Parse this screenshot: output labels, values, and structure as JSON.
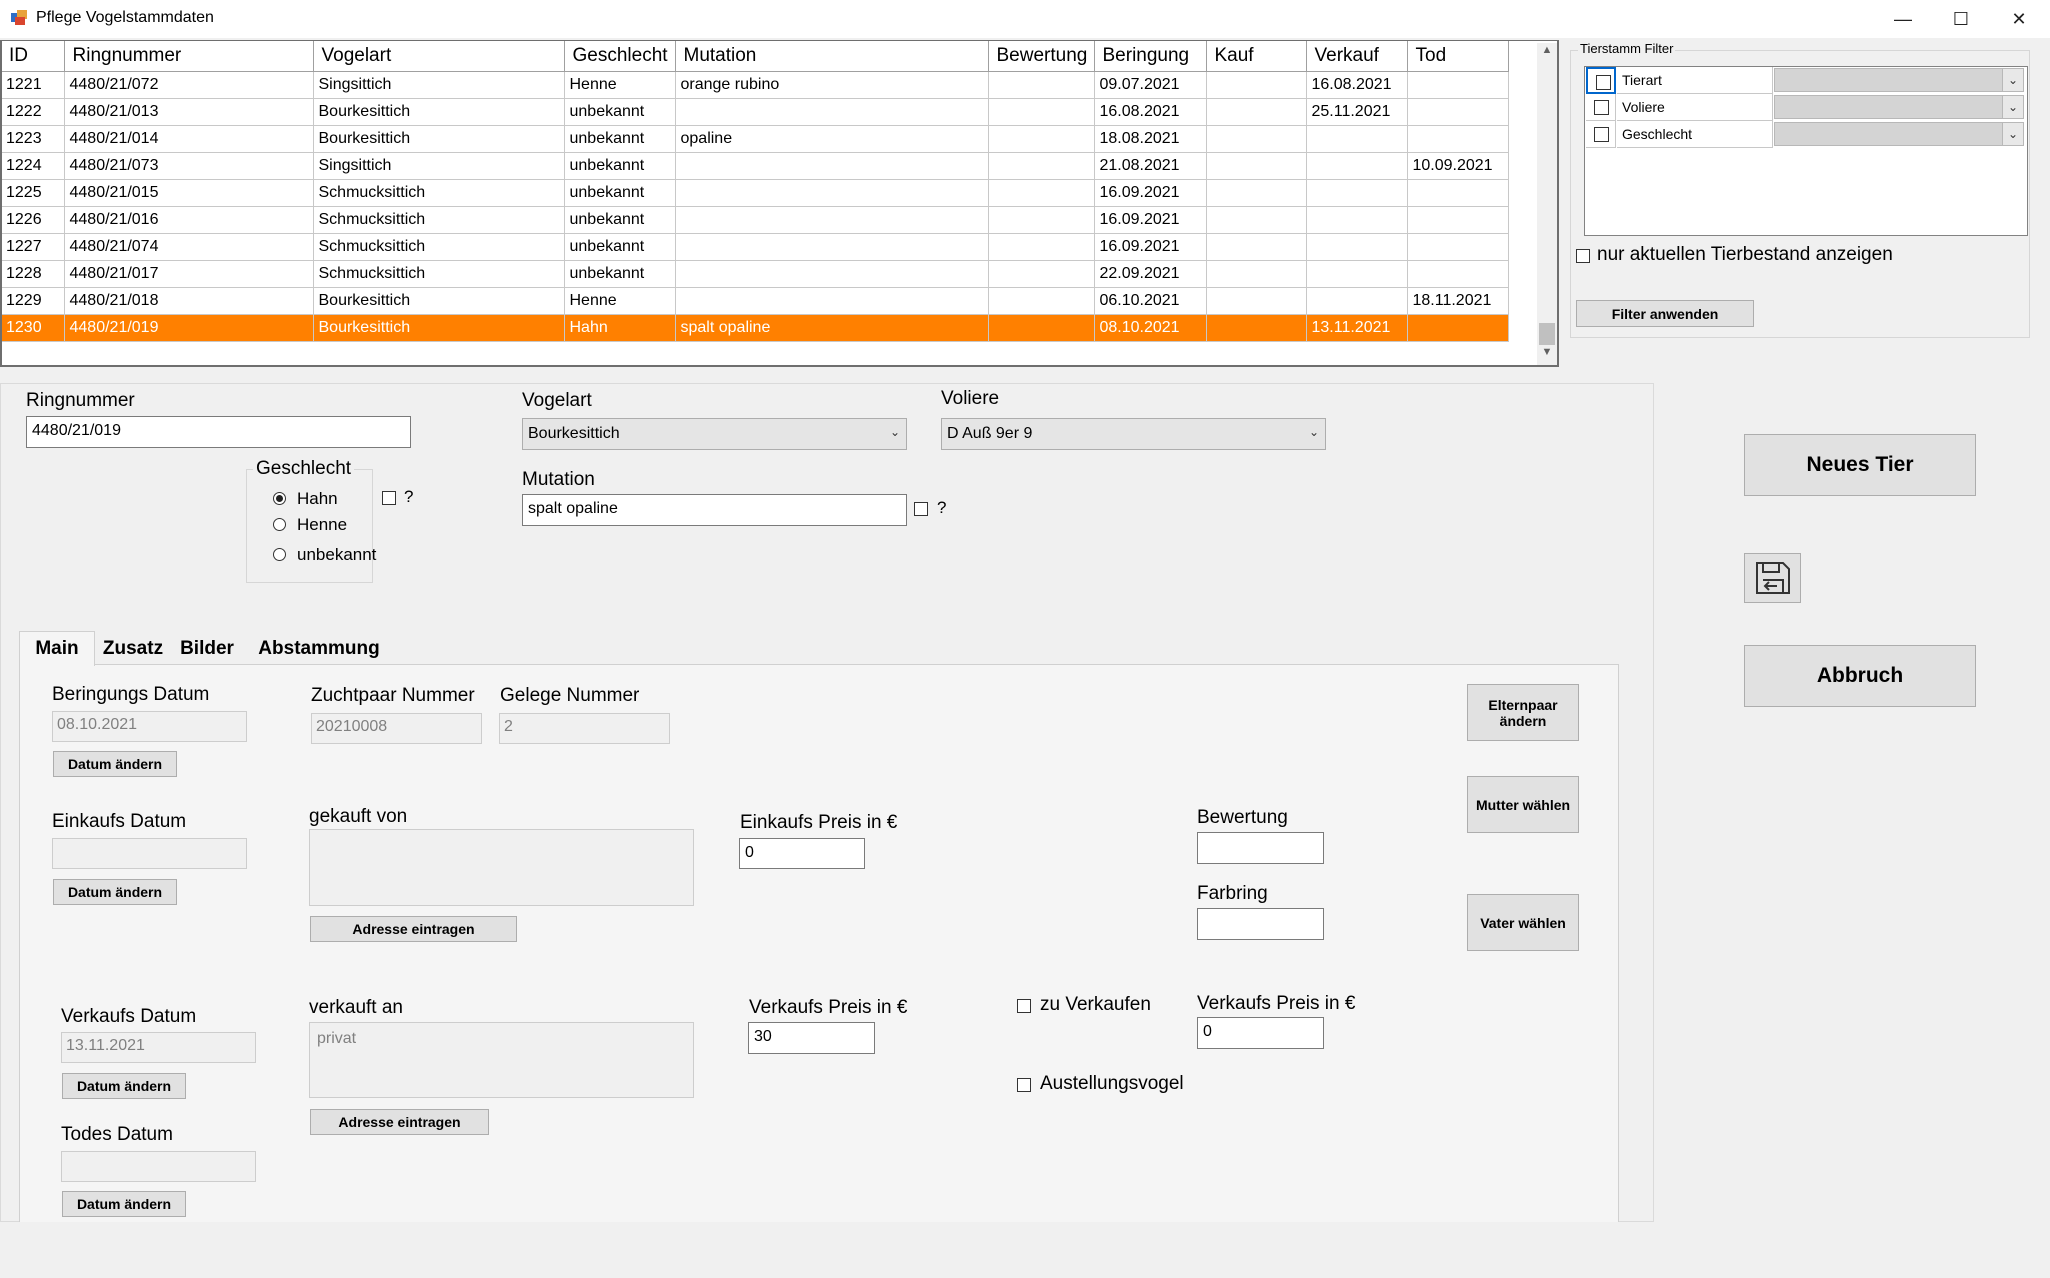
{
  "window": {
    "title": "Pflege Vogelstammdaten",
    "controls": {
      "minimize": "—",
      "maximize": "☐",
      "close": "✕"
    }
  },
  "grid": {
    "columns": [
      "ID",
      "Ringnummer",
      "Vogelart",
      "Geschlecht",
      "Mutation",
      "Bewertung",
      "Beringung",
      "Kauf",
      "Verkauf",
      "Tod"
    ],
    "rows": [
      [
        "1221",
        "4480/21/072",
        "Singsittich",
        "Henne",
        "orange rubino",
        "",
        "09.07.2021",
        "",
        "16.08.2021",
        ""
      ],
      [
        "1222",
        "4480/21/013",
        "Bourkesittich",
        "unbekannt",
        "",
        "",
        "16.08.2021",
        "",
        "25.11.2021",
        ""
      ],
      [
        "1223",
        "4480/21/014",
        "Bourkesittich",
        "unbekannt",
        "opaline",
        "",
        "18.08.2021",
        "",
        "",
        ""
      ],
      [
        "1224",
        "4480/21/073",
        "Singsittich",
        "unbekannt",
        "",
        "",
        "21.08.2021",
        "",
        "",
        "10.09.2021"
      ],
      [
        "1225",
        "4480/21/015",
        "Schmucksittich",
        "unbekannt",
        "",
        "",
        "16.09.2021",
        "",
        "",
        ""
      ],
      [
        "1226",
        "4480/21/016",
        "Schmucksittich",
        "unbekannt",
        "",
        "",
        "16.09.2021",
        "",
        "",
        ""
      ],
      [
        "1227",
        "4480/21/074",
        "Schmucksittich",
        "unbekannt",
        "",
        "",
        "16.09.2021",
        "",
        "",
        ""
      ],
      [
        "1228",
        "4480/21/017",
        "Schmucksittich",
        "unbekannt",
        "",
        "",
        "22.09.2021",
        "",
        "",
        ""
      ],
      [
        "1229",
        "4480/21/018",
        "Bourkesittich",
        "Henne",
        "",
        "",
        "06.10.2021",
        "",
        "",
        "18.11.2021"
      ],
      [
        "1230",
        "4480/21/019",
        "Bourkesittich",
        "Hahn",
        "spalt opaline",
        "",
        "08.10.2021",
        "",
        "13.11.2021",
        ""
      ]
    ],
    "selected_row": 9,
    "selection_color": "#ff8000"
  },
  "filter": {
    "title": "Tierstamm Filter",
    "rows": [
      {
        "label": "Tierart",
        "checked": false
      },
      {
        "label": "Voliere",
        "checked": false
      },
      {
        "label": "Geschlecht",
        "checked": false
      }
    ],
    "current_stock_label": "nur aktuellen Tierbestand anzeigen",
    "apply_label": "Filter anwenden"
  },
  "form": {
    "ringnummer_label": "Ringnummer",
    "ringnummer_value": "4480/21/019",
    "vogelart_label": "Vogelart",
    "vogelart_value": "Bourkesittich",
    "voliere_label": "Voliere",
    "voliere_value": "D Auß 9er 9",
    "geschlecht_label": "Geschlecht",
    "geschlecht_options": [
      "Hahn",
      "Henne",
      "unbekannt"
    ],
    "geschlecht_selected": "Hahn",
    "unsure_label": "?",
    "mutation_label": "Mutation",
    "mutation_value": "spalt opaline"
  },
  "actions": {
    "new_label": "Neues Tier",
    "cancel_label": "Abbruch",
    "save_icon": "save-icon"
  },
  "tabs": [
    "Main",
    "Zusatz",
    "Bilder",
    "Abstammung"
  ],
  "main_tab": {
    "beringung_label": "Beringungs Datum",
    "beringung_value": "08.10.2021",
    "zuchtpaar_label": "Zuchtpaar Nummer",
    "zuchtpaar_value": "20210008",
    "gelege_label": "Gelege Nummer",
    "gelege_value": "2",
    "date_change_label": "Datum ändern",
    "einkauf_label": "Einkaufs Datum",
    "einkauf_value": "",
    "gekauft_von_label": "gekauft von",
    "gekauft_von_value": "",
    "address_label": "Adresse eintragen",
    "einkaufspreis_label": "Einkaufs Preis in €",
    "einkaufspreis_value": "0",
    "bewertung_label": "Bewertung",
    "bewertung_value": "",
    "farbring_label": "Farbring",
    "farbring_value": "",
    "verkauf_label": "Verkaufs Datum",
    "verkauf_value": "13.11.2021",
    "verkauft_an_label": "verkauft an",
    "verkauft_an_value": "privat",
    "verkaufspreis_label": "Verkaufs Preis in €",
    "verkaufspreis_value": "30",
    "zu_verkaufen_label": "zu Verkaufen",
    "verkaufspreis2_label": "Verkaufs Preis in €",
    "verkaufspreis2_value": "0",
    "ausstellung_label": "Austellungsvogel",
    "todes_label": "Todes Datum",
    "todes_value": "",
    "elternpaar_label": "Elternpaar ändern",
    "mutter_label": "Mutter wählen",
    "vater_label": "Vater wählen"
  }
}
